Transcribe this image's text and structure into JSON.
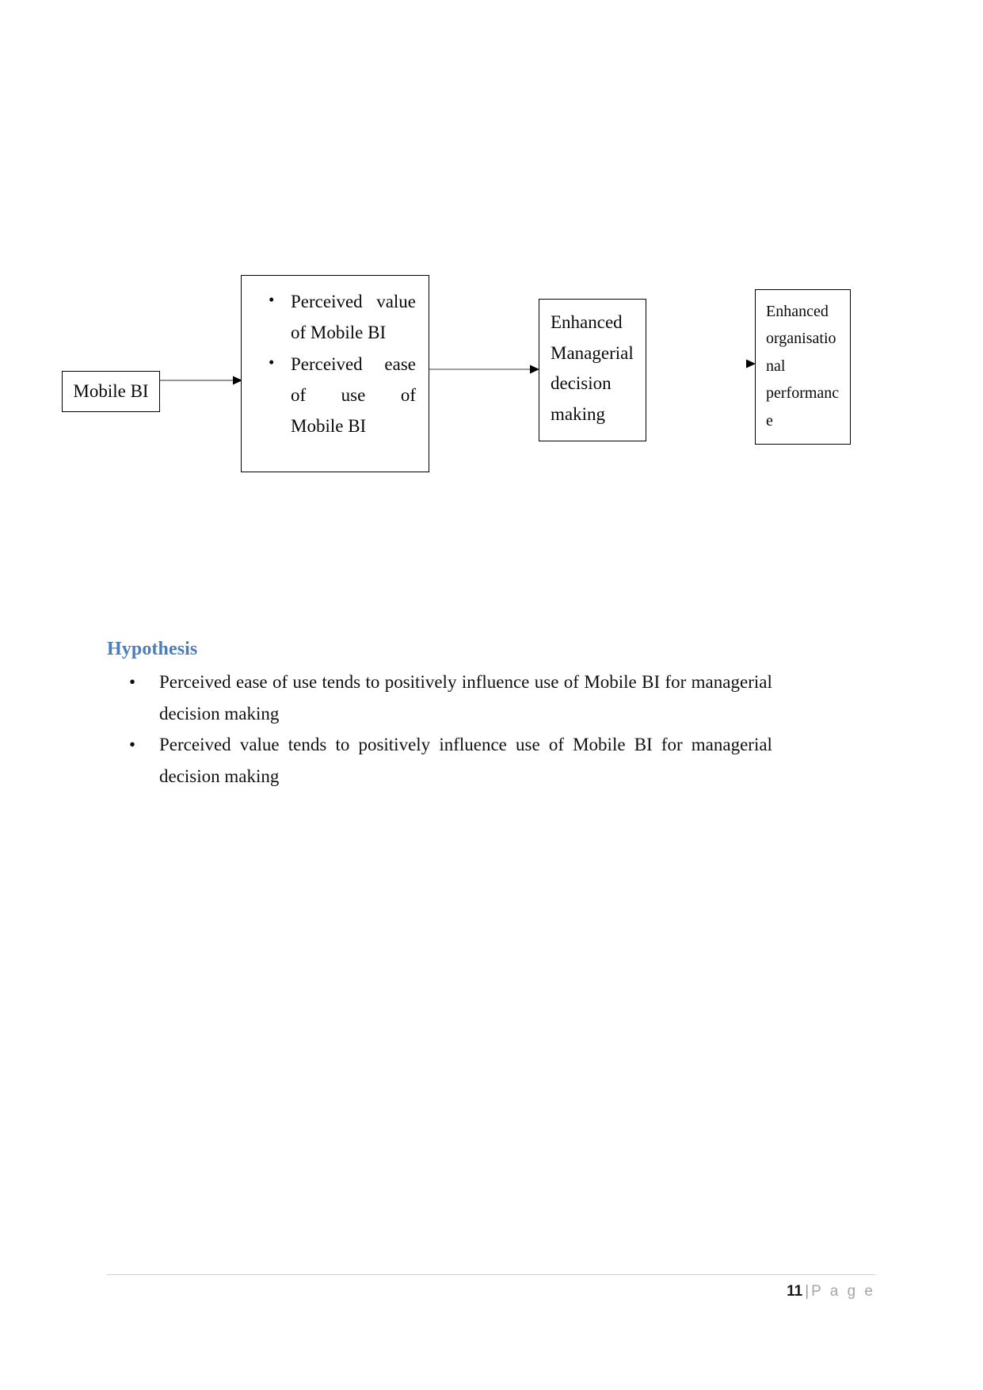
{
  "document": {
    "page_label": "11",
    "footer_separator": "|",
    "footer_word": "P a g e"
  },
  "diagram": {
    "name": "mobile-bi-conceptual-model",
    "boxes": [
      {
        "id": "mobile-bi",
        "text": "Mobile BI"
      },
      {
        "id": "perceptions",
        "bullets": [
          {
            "line1_a": "Perceived",
            "line1_b": "value",
            "line2": "of Mobile BI"
          },
          {
            "line1_a": "Perceived",
            "line1_b": "ease",
            "line2_a": "of",
            "line2_b": "use",
            "line2_c": "of",
            "line3": "Mobile BI"
          }
        ]
      },
      {
        "id": "decision",
        "lines": [
          "Enhanced",
          "Managerial",
          "decision",
          "making"
        ]
      },
      {
        "id": "performance",
        "lines": [
          "Enhanced",
          "organisatio",
          "nal",
          "performanc",
          "e"
        ]
      }
    ],
    "arrows": [
      {
        "id": "arrow-mobilebi-to-perceptions"
      },
      {
        "id": "arrow-perceptions-to-decision"
      },
      {
        "id": "arrow-decision-to-performance"
      }
    ]
  },
  "hypothesis": {
    "heading": "Hypothesis",
    "items": [
      {
        "line1_words": [
          "Perceived",
          "ease",
          "of",
          "use",
          "tends",
          "to",
          "positively",
          "influence",
          "use",
          "of",
          "Mobile",
          "BI",
          "for",
          "managerial"
        ],
        "line2": "decision making"
      },
      {
        "line1_words": [
          "Perceived",
          "value",
          "tends",
          "to",
          "positively",
          "influence",
          "use",
          "of",
          "Mobile",
          "BI",
          "for",
          "managerial"
        ],
        "line2": "decision making"
      }
    ]
  },
  "colors": {
    "heading_blue": "#4a7ebb",
    "box_border": "#000000",
    "text": "#000000",
    "footer_gray": "#a6a6a6",
    "rule_gray": "#cfcfcf"
  }
}
